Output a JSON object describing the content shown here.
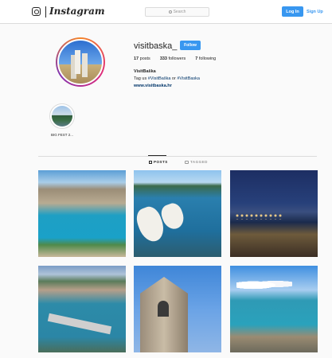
{
  "header": {
    "wordmark": "Instagram",
    "search_placeholder": "Search",
    "login_label": "Log In",
    "signup_label": "Sign Up"
  },
  "profile": {
    "username": "visitbaska_",
    "follow_label": "Follow",
    "posts_count": "17",
    "posts_label": "posts",
    "followers_count": "333",
    "followers_label": "followers",
    "following_count": "7",
    "following_label": "following",
    "full_name": "VisitBaška",
    "bio_prefix": "Tag us",
    "bio_tag1": "#VisitBaška",
    "bio_or": "or",
    "bio_tag2": "#VisitBaska",
    "website": "www.visitbaska.hr"
  },
  "highlights": [
    {
      "label": "BIG FEST 2..."
    }
  ],
  "tabs": {
    "posts": "POSTS",
    "tagged": "TAGGED"
  },
  "icons": {
    "instagram": "instagram-logo-icon",
    "search": "search-icon",
    "grid": "grid-icon",
    "tagged": "tag-icon"
  },
  "colors": {
    "accent": "#3897f0",
    "link": "#003569",
    "text": "#262626",
    "border": "#dbdbdb"
  }
}
